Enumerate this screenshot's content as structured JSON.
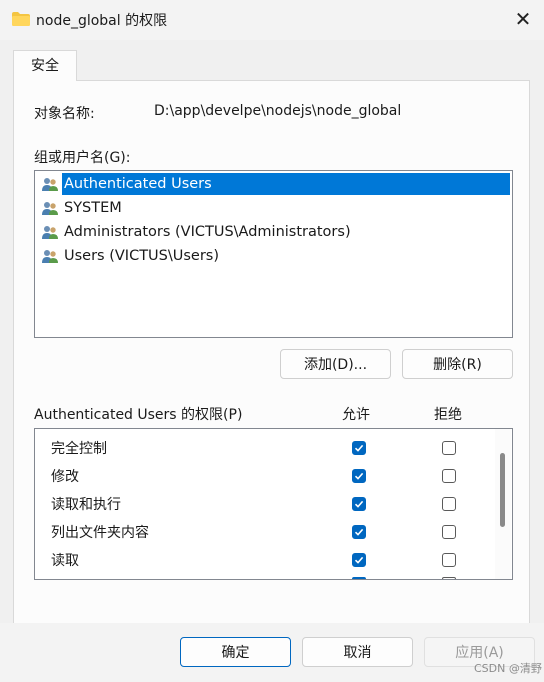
{
  "window": {
    "title": "node_global 的权限",
    "close_glyph": "✕"
  },
  "tabs": [
    {
      "label": "安全",
      "active": true
    }
  ],
  "object": {
    "label": "对象名称:",
    "value": "D:\\app\\develpe\\nodejs\\node_global"
  },
  "groups": {
    "label": "组或用户名(G):",
    "items": [
      {
        "label": "Authenticated Users",
        "selected": true,
        "icon": "users-icon"
      },
      {
        "label": "SYSTEM",
        "selected": false,
        "icon": "users-icon"
      },
      {
        "label": "Administrators (VICTUS\\Administrators)",
        "selected": false,
        "icon": "users-icon"
      },
      {
        "label": "Users (VICTUS\\Users)",
        "selected": false,
        "icon": "users-icon"
      }
    ],
    "add_button": "添加(D)...",
    "remove_button": "删除(R)"
  },
  "permissions": {
    "title": "Authenticated Users 的权限(P)",
    "allow_header": "允许",
    "deny_header": "拒绝",
    "rows": [
      {
        "name": "完全控制",
        "allow": true,
        "deny": false
      },
      {
        "name": "修改",
        "allow": true,
        "deny": false
      },
      {
        "name": "读取和执行",
        "allow": true,
        "deny": false
      },
      {
        "name": "列出文件夹内容",
        "allow": true,
        "deny": false
      },
      {
        "name": "读取",
        "allow": true,
        "deny": false
      }
    ]
  },
  "footer": {
    "ok": "确定",
    "cancel": "取消",
    "apply": "应用(A)"
  },
  "watermark": "CSDN @清野",
  "colors": {
    "accent": "#0067c0",
    "selection": "#0078d7"
  }
}
